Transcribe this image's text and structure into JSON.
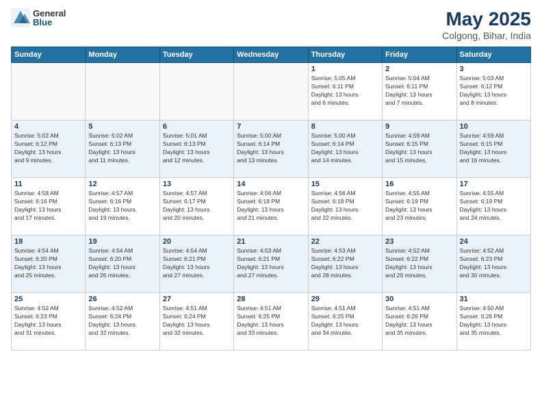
{
  "header": {
    "logo_general": "General",
    "logo_blue": "Blue",
    "month_year": "May 2025",
    "location": "Colgong, Bihar, India"
  },
  "weekdays": [
    "Sunday",
    "Monday",
    "Tuesday",
    "Wednesday",
    "Thursday",
    "Friday",
    "Saturday"
  ],
  "weeks": [
    [
      {
        "day": "",
        "info": ""
      },
      {
        "day": "",
        "info": ""
      },
      {
        "day": "",
        "info": ""
      },
      {
        "day": "",
        "info": ""
      },
      {
        "day": "1",
        "info": "Sunrise: 5:05 AM\nSunset: 6:11 PM\nDaylight: 13 hours\nand 6 minutes."
      },
      {
        "day": "2",
        "info": "Sunrise: 5:04 AM\nSunset: 6:11 PM\nDaylight: 13 hours\nand 7 minutes."
      },
      {
        "day": "3",
        "info": "Sunrise: 5:03 AM\nSunset: 6:12 PM\nDaylight: 13 hours\nand 8 minutes."
      }
    ],
    [
      {
        "day": "4",
        "info": "Sunrise: 5:02 AM\nSunset: 6:12 PM\nDaylight: 13 hours\nand 9 minutes."
      },
      {
        "day": "5",
        "info": "Sunrise: 5:02 AM\nSunset: 6:13 PM\nDaylight: 13 hours\nand 11 minutes."
      },
      {
        "day": "6",
        "info": "Sunrise: 5:01 AM\nSunset: 6:13 PM\nDaylight: 13 hours\nand 12 minutes."
      },
      {
        "day": "7",
        "info": "Sunrise: 5:00 AM\nSunset: 6:14 PM\nDaylight: 13 hours\nand 13 minutes."
      },
      {
        "day": "8",
        "info": "Sunrise: 5:00 AM\nSunset: 6:14 PM\nDaylight: 13 hours\nand 14 minutes."
      },
      {
        "day": "9",
        "info": "Sunrise: 4:59 AM\nSunset: 6:15 PM\nDaylight: 13 hours\nand 15 minutes."
      },
      {
        "day": "10",
        "info": "Sunrise: 4:59 AM\nSunset: 6:15 PM\nDaylight: 13 hours\nand 16 minutes."
      }
    ],
    [
      {
        "day": "11",
        "info": "Sunrise: 4:58 AM\nSunset: 6:16 PM\nDaylight: 13 hours\nand 17 minutes."
      },
      {
        "day": "12",
        "info": "Sunrise: 4:57 AM\nSunset: 6:16 PM\nDaylight: 13 hours\nand 19 minutes."
      },
      {
        "day": "13",
        "info": "Sunrise: 4:57 AM\nSunset: 6:17 PM\nDaylight: 13 hours\nand 20 minutes."
      },
      {
        "day": "14",
        "info": "Sunrise: 4:56 AM\nSunset: 6:18 PM\nDaylight: 13 hours\nand 21 minutes."
      },
      {
        "day": "15",
        "info": "Sunrise: 4:56 AM\nSunset: 6:18 PM\nDaylight: 13 hours\nand 22 minutes."
      },
      {
        "day": "16",
        "info": "Sunrise: 4:55 AM\nSunset: 6:19 PM\nDaylight: 13 hours\nand 23 minutes."
      },
      {
        "day": "17",
        "info": "Sunrise: 4:55 AM\nSunset: 6:19 PM\nDaylight: 13 hours\nand 24 minutes."
      }
    ],
    [
      {
        "day": "18",
        "info": "Sunrise: 4:54 AM\nSunset: 6:20 PM\nDaylight: 13 hours\nand 25 minutes."
      },
      {
        "day": "19",
        "info": "Sunrise: 4:54 AM\nSunset: 6:20 PM\nDaylight: 13 hours\nand 26 minutes."
      },
      {
        "day": "20",
        "info": "Sunrise: 4:54 AM\nSunset: 6:21 PM\nDaylight: 13 hours\nand 27 minutes."
      },
      {
        "day": "21",
        "info": "Sunrise: 4:53 AM\nSunset: 6:21 PM\nDaylight: 13 hours\nand 27 minutes."
      },
      {
        "day": "22",
        "info": "Sunrise: 4:53 AM\nSunset: 6:22 PM\nDaylight: 13 hours\nand 28 minutes."
      },
      {
        "day": "23",
        "info": "Sunrise: 4:52 AM\nSunset: 6:22 PM\nDaylight: 13 hours\nand 29 minutes."
      },
      {
        "day": "24",
        "info": "Sunrise: 4:52 AM\nSunset: 6:23 PM\nDaylight: 13 hours\nand 30 minutes."
      }
    ],
    [
      {
        "day": "25",
        "info": "Sunrise: 4:52 AM\nSunset: 6:23 PM\nDaylight: 13 hours\nand 31 minutes."
      },
      {
        "day": "26",
        "info": "Sunrise: 4:52 AM\nSunset: 6:24 PM\nDaylight: 13 hours\nand 32 minutes."
      },
      {
        "day": "27",
        "info": "Sunrise: 4:51 AM\nSunset: 6:24 PM\nDaylight: 13 hours\nand 32 minutes."
      },
      {
        "day": "28",
        "info": "Sunrise: 4:51 AM\nSunset: 6:25 PM\nDaylight: 13 hours\nand 33 minutes."
      },
      {
        "day": "29",
        "info": "Sunrise: 4:51 AM\nSunset: 6:25 PM\nDaylight: 13 hours\nand 34 minutes."
      },
      {
        "day": "30",
        "info": "Sunrise: 4:51 AM\nSunset: 6:26 PM\nDaylight: 13 hours\nand 35 minutes."
      },
      {
        "day": "31",
        "info": "Sunrise: 4:50 AM\nSunset: 6:26 PM\nDaylight: 13 hours\nand 35 minutes."
      }
    ]
  ]
}
